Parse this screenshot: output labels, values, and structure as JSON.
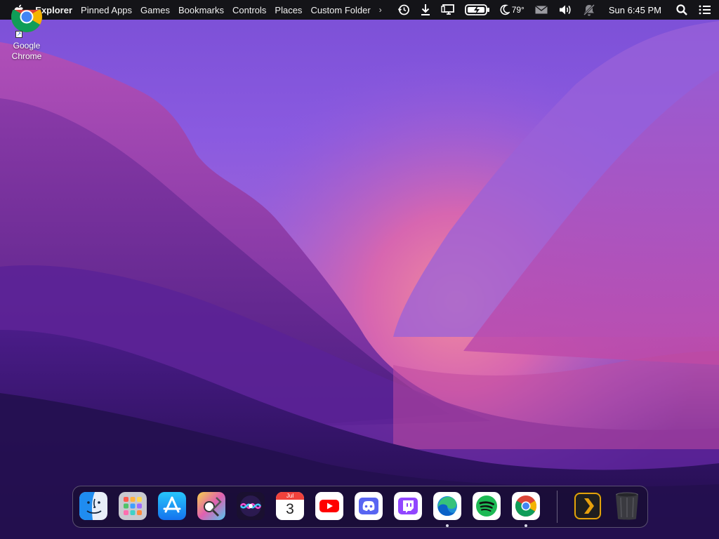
{
  "menubar": {
    "items": [
      "Explorer",
      "Pinned Apps",
      "Games",
      "Bookmarks",
      "Controls",
      "Places",
      "Custom Folder"
    ],
    "overflow_glyph": "›",
    "weather": {
      "icon": "moon-icon",
      "temp": "79°"
    },
    "clock": "Sun 6:45 PM",
    "tray_icons": [
      "history-icon",
      "download-icon",
      "display-icon",
      "battery-charging-icon",
      "moon-icon",
      "mail-icon",
      "volume-icon",
      "notifications-off-icon",
      "search-icon",
      "list-icon"
    ]
  },
  "desktop": {
    "icons": [
      {
        "label": "Google Chrome",
        "icon": "chrome-icon"
      }
    ]
  },
  "dock": {
    "apps": [
      {
        "icon": "finder-icon",
        "running": false
      },
      {
        "icon": "launchpad-icon",
        "running": false
      },
      {
        "icon": "app-store-icon",
        "running": false
      },
      {
        "icon": "system-tools-icon",
        "running": false
      },
      {
        "icon": "siri-icon",
        "running": false
      },
      {
        "icon": "calendar-icon",
        "running": false,
        "month": "Jul",
        "day": "3"
      },
      {
        "icon": "youtube-icon",
        "running": false
      },
      {
        "icon": "discord-icon",
        "running": false
      },
      {
        "icon": "twitch-icon",
        "running": false
      },
      {
        "icon": "edge-icon",
        "running": true
      },
      {
        "icon": "spotify-icon",
        "running": false
      },
      {
        "icon": "chrome-icon",
        "running": true
      },
      {
        "icon": "plex-icon",
        "running": false
      },
      {
        "icon": "trash-icon",
        "running": false
      }
    ]
  },
  "colors": {
    "menubar_bg": "#141418",
    "wallpaper_top": "#7b4fd6",
    "wallpaper_glow": "#e47a9a",
    "wallpaper_dark": "#2c1460"
  }
}
